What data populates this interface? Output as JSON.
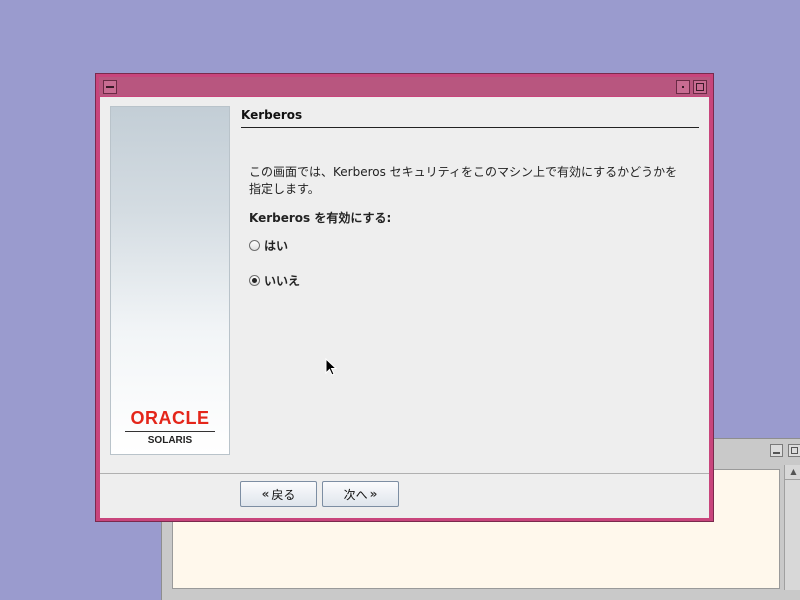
{
  "dialog": {
    "section_title": "Kerberos",
    "description": "この画面では、Kerberos セキュリティをこのマシン上で有効にするかどうかを\n指定します。",
    "prompt": "Kerberos を有効にする:",
    "options": [
      {
        "label": "はい",
        "selected": false
      },
      {
        "label": "いいえ",
        "selected": true
      }
    ],
    "buttons": {
      "back_label": "戻る",
      "next_label": "次へ"
    }
  },
  "branding": {
    "logo_text": "ORACLE",
    "product_text": "SOLARIS",
    "logo_color": "#e4261a"
  },
  "colors": {
    "desktop": "#9a9bce",
    "window_frame": "#c8457c",
    "dialog_bg": "#eeeeee",
    "terminal_bg": "#fff8ec"
  },
  "icons": {
    "back": "double-chevron-left-icon",
    "next": "double-chevron-right-icon",
    "window_menu": "window-menu-icon",
    "minimize": "minimize-icon",
    "maximize": "maximize-icon"
  }
}
